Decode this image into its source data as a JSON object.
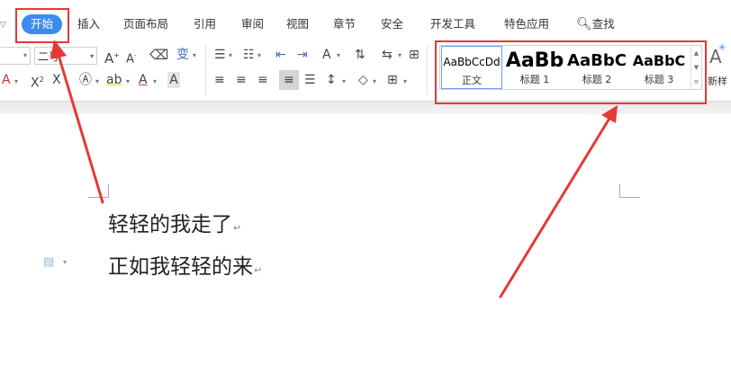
{
  "menu": {
    "items": [
      {
        "label": "开始",
        "active": true
      },
      {
        "label": "插入"
      },
      {
        "label": "页面布局"
      },
      {
        "label": "引用"
      },
      {
        "label": "审阅"
      },
      {
        "label": "视图"
      },
      {
        "label": "章节"
      },
      {
        "label": "安全"
      },
      {
        "label": "开发工具"
      },
      {
        "label": "特色应用"
      }
    ],
    "search_label": "查找",
    "accent": "#3c8cf0"
  },
  "ribbon": {
    "font_size_value": "二号"
  },
  "styles_gallery": {
    "tiles": [
      {
        "preview": "AaBbCcDd",
        "label": "正文",
        "selected": true
      },
      {
        "preview": "AaBb",
        "label": "标题 1"
      },
      {
        "preview": "AaBbC",
        "label": "标题 2"
      },
      {
        "preview": "AaBbC",
        "label": "标题 3"
      }
    ],
    "new_style_label": "新样"
  },
  "document": {
    "lines": [
      "轻轻的我走了",
      "正如我轻轻的来"
    ],
    "paragraph_mark": "↵"
  },
  "annotations": {
    "color": "#e53935"
  }
}
